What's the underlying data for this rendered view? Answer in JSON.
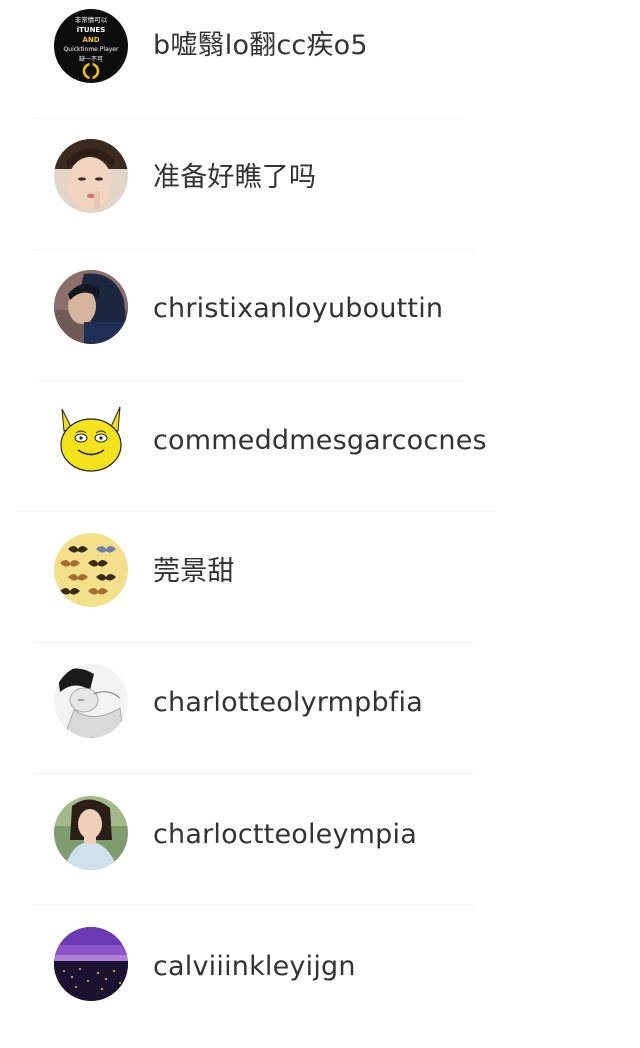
{
  "users": [
    {
      "name": "b嘘翳lo翻cc疾o5",
      "avatar": "avatar-itunes-badge",
      "avatar_text": {
        "line1": "非常情可以",
        "line2": "iTUNES",
        "line3": "AND",
        "line4": "Quicktinme Player",
        "line5": "缺一不可"
      }
    },
    {
      "name": "准备好瞧了吗",
      "avatar": "avatar-girl-photo"
    },
    {
      "name": "christixanloyubouttin",
      "avatar": "avatar-man-photo"
    },
    {
      "name": "commeddmesgarcocnes",
      "avatar": "avatar-pikachu-meme"
    },
    {
      "name": "莞景甜",
      "avatar": "avatar-mustache-pattern"
    },
    {
      "name": "charlotteolyrmpbfia",
      "avatar": "avatar-bw-sketch"
    },
    {
      "name": "charloctteoleympia",
      "avatar": "avatar-woman-photo"
    },
    {
      "name": "calviiinkleyijgn",
      "avatar": "avatar-night-city-photo"
    }
  ],
  "colors": {
    "text": "#333333",
    "divider": "#f2f2f2",
    "background": "#ffffff"
  }
}
